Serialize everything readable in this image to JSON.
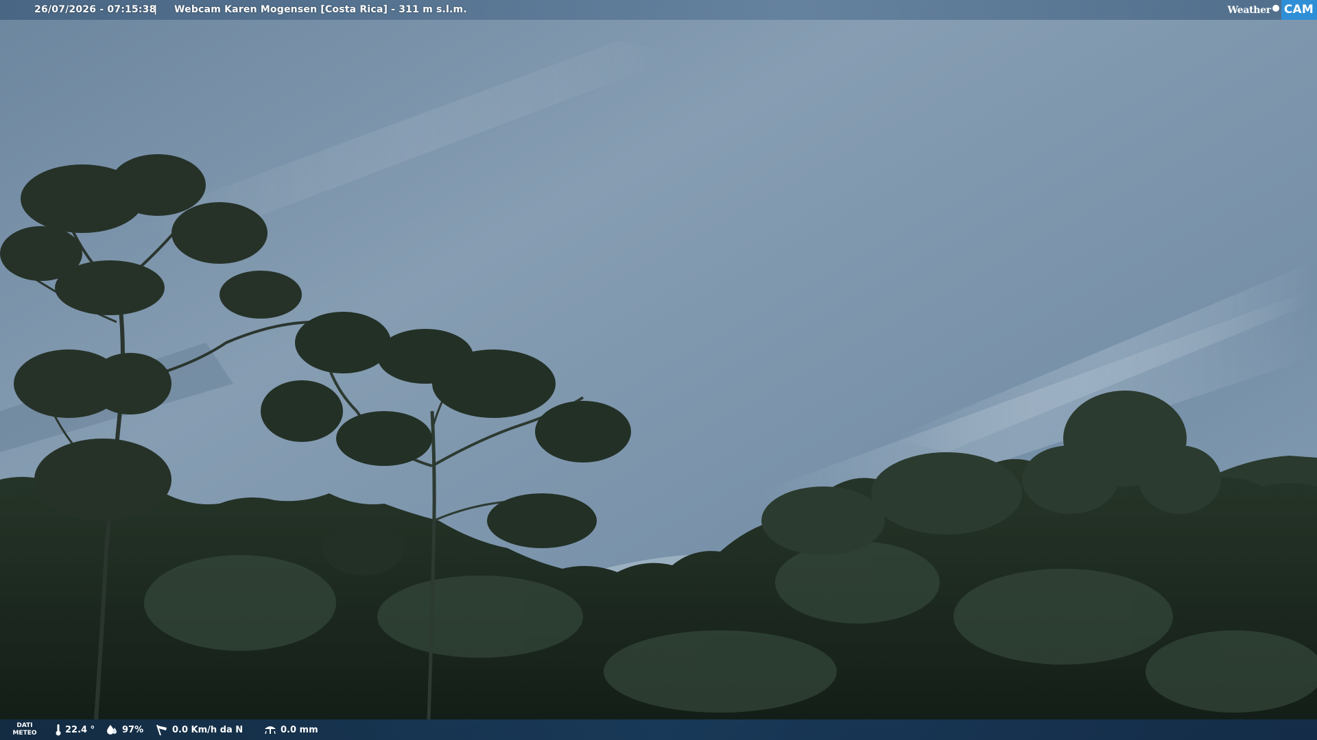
{
  "overlay": {
    "datetime": "26/07/2026 - 07:15:38",
    "separator": "|",
    "camera_title": "Webcam Karen Mogensen [Costa Rica]  - 311 m s.l.m.",
    "logo": {
      "weather": "Weather",
      "cam": "CAM"
    }
  },
  "weather_bar": {
    "label_line1": "DATI",
    "label_line2": "METEO",
    "temperature": "22.4 °",
    "humidity": "97%",
    "wind": "0.0 Km/h da N",
    "rain": "0.0 mm"
  },
  "icons": [
    "thermometer-icon",
    "humidity-drop-icon",
    "wind-windsock-icon",
    "rain-gauge-icon"
  ],
  "colors": {
    "sky": "#7f97ad",
    "foliage": "#1f2e22",
    "top_bar": "#4a6a8c",
    "bottom_bar": "#183a5c",
    "logo_accent": "#2f8fd6"
  }
}
